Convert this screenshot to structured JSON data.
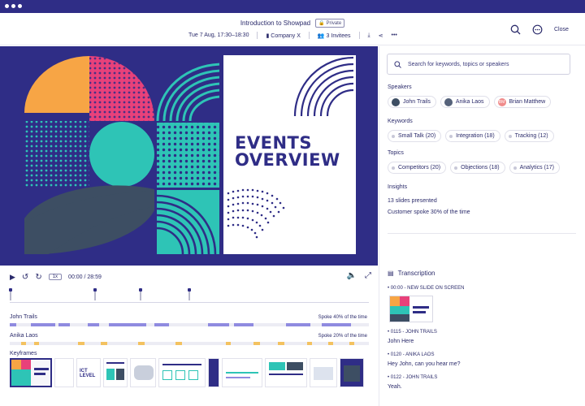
{
  "header": {
    "title": "Introduction to Showpad",
    "privacy": "Private",
    "date": "Tue 7 Aug, 17:30–18:30",
    "company": "Company X",
    "invites": "3 Invitees",
    "close": "Close"
  },
  "slide": {
    "title_line1": "EVENTS",
    "title_line2": "OVERVIEW"
  },
  "player": {
    "speed": "1x",
    "time": "00:00 / 28:59",
    "progress": 0
  },
  "tracks": [
    {
      "name": "John Trails",
      "summary": "Spoke 40% of the time"
    },
    {
      "name": "Anika Laos",
      "summary": "Spoke 20% of the time"
    }
  ],
  "keyframes_label": "Keyframes",
  "keyframe_texts": {
    "k3": "ICT LEVEL"
  },
  "sidebar": {
    "search_placeholder": "Search for keywords, topics or speakers",
    "speakers_label": "Speakers",
    "speakers": [
      "John Trails",
      "Anika Laos",
      "Brian Matthew"
    ],
    "speaker_initials": {
      "brian": "BM"
    },
    "keywords_label": "Keywords",
    "keywords": [
      "Small Talk (20)",
      "Integration (18)",
      "Tracking (12)"
    ],
    "topics_label": "Topics",
    "topics": [
      "Competitors (20)",
      "Objections (18)",
      "Analytics (17)"
    ],
    "insights_label": "Insights",
    "insights": [
      "13 slides presented",
      "Customer spoke 30% of the time"
    ]
  },
  "transcription": {
    "title": "Transcription",
    "entries": [
      {
        "time": "00:00 - NEW SLIDE ON SCREEN",
        "text": ""
      },
      {
        "time": "0115 - JOHN TRAILS",
        "text": "John Here"
      },
      {
        "time": "0120 - ANIKA LAOS",
        "text": "Hey John, can you hear me?"
      },
      {
        "time": "0122 - JOHN TRAILS",
        "text": "Yeah."
      }
    ]
  },
  "colors": {
    "brand": "#2f2d86",
    "teal": "#2ec4b6",
    "pink": "#e8417a",
    "orange": "#f7a545",
    "slate": "#3d4e63",
    "john_track": "#8f8be0",
    "anika_track": "#f3c260"
  },
  "icons": {
    "play": "play-icon",
    "rewind": "rewind-icon",
    "forward": "forward-icon",
    "volume": "volume-icon",
    "fullscreen": "fullscreen-icon",
    "search": "search-icon",
    "comment": "comment-icon"
  }
}
